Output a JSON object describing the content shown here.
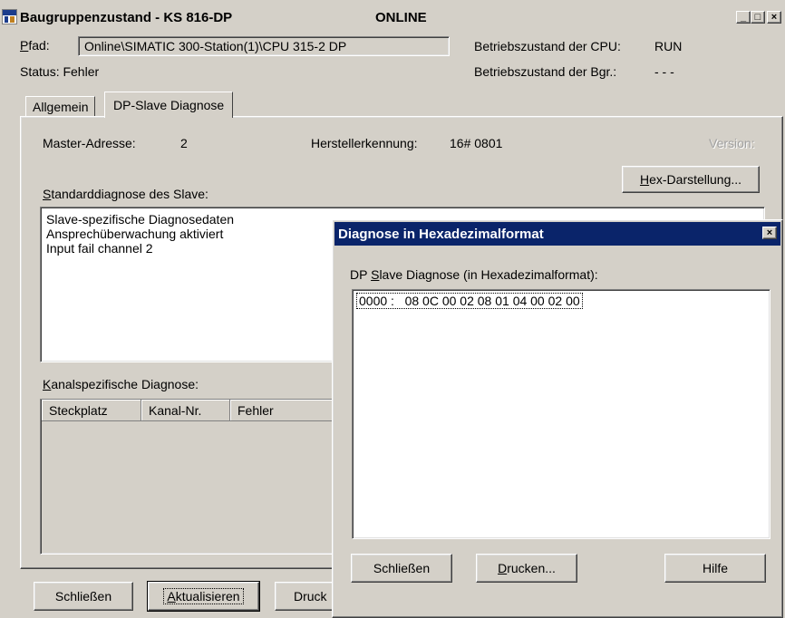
{
  "main_window": {
    "title": "Baugruppenzustand - KS 816-DP",
    "online": "ONLINE",
    "caption_buttons": {
      "minimize": "_",
      "maximize": "□",
      "close": "×"
    },
    "path_label_char": "P",
    "path_label_rest": "fad:",
    "path_value": "Online\\SIMATIC 300-Station(1)\\CPU 315-2 DP",
    "status": "Status: Fehler",
    "cpu_mode_label": "Betriebszustand der CPU:",
    "cpu_mode_value": "RUN",
    "module_mode_label": "Betriebszustand der Bgr.:",
    "module_mode_value": "- - -",
    "tabs": [
      {
        "label": "Allgemein"
      },
      {
        "label": "DP-Slave Diagnose"
      }
    ],
    "master_address_label": "Master-Adresse:",
    "master_address_value": "2",
    "vendor_id_label": "Herstellerkennung:",
    "vendor_id_value": "16# 0801",
    "version_label": "Version:",
    "hex_button_char": "H",
    "hex_button_rest": "ex-Darstellung...",
    "std_diag_label_char": "S",
    "std_diag_label_rest": "tandarddiagnose des Slave:",
    "std_diag_items": [
      "Slave-spezifische Diagnosedaten",
      "Ansprechüberwachung aktiviert",
      "Input fail channel 2"
    ],
    "channel_diag_label_char": "K",
    "channel_diag_label_rest": "analspezifische Diagnose:",
    "table_headers": [
      "Steckplatz",
      "Kanal-Nr.",
      "Fehler"
    ],
    "btn_close": "Schließen",
    "btn_update_char": "A",
    "btn_update_rest": "ktualisieren",
    "btn_print_partial": "Druck"
  },
  "hex_dialog": {
    "title": "Diagnose in Hexadezimalformat",
    "close_glyph": "×",
    "label_pre": "DP ",
    "label_char": "S",
    "label_rest": "lave Diagnose (in Hexadezimalformat):",
    "lines": [
      "0000 :   08 0C 00 02 08 01 04 00 02 00"
    ],
    "btn_close": "Schließen",
    "btn_print_char": "D",
    "btn_print_rest": "rucken...",
    "btn_help": "Hilfe"
  },
  "colors": {
    "face": "#d4d0c8",
    "title_active": "#0a246a",
    "title_inactive_bg": "#d4d0c8",
    "online": "#0000a8"
  }
}
